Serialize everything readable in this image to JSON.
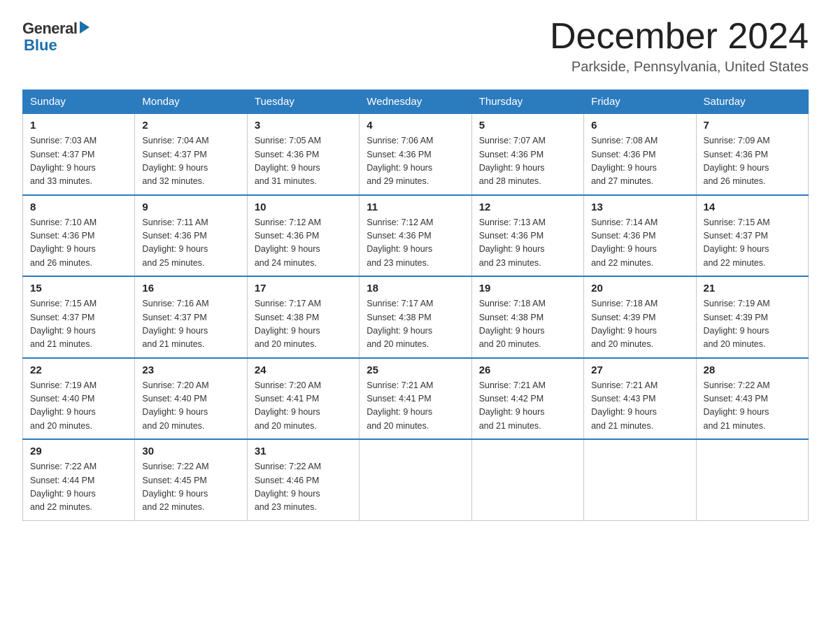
{
  "header": {
    "logo_general": "General",
    "logo_blue": "Blue",
    "month_title": "December 2024",
    "location": "Parkside, Pennsylvania, United States"
  },
  "weekdays": [
    "Sunday",
    "Monday",
    "Tuesday",
    "Wednesday",
    "Thursday",
    "Friday",
    "Saturday"
  ],
  "weeks": [
    [
      {
        "day": "1",
        "sunrise": "7:03 AM",
        "sunset": "4:37 PM",
        "daylight": "9 hours and 33 minutes."
      },
      {
        "day": "2",
        "sunrise": "7:04 AM",
        "sunset": "4:37 PM",
        "daylight": "9 hours and 32 minutes."
      },
      {
        "day": "3",
        "sunrise": "7:05 AM",
        "sunset": "4:36 PM",
        "daylight": "9 hours and 31 minutes."
      },
      {
        "day": "4",
        "sunrise": "7:06 AM",
        "sunset": "4:36 PM",
        "daylight": "9 hours and 29 minutes."
      },
      {
        "day": "5",
        "sunrise": "7:07 AM",
        "sunset": "4:36 PM",
        "daylight": "9 hours and 28 minutes."
      },
      {
        "day": "6",
        "sunrise": "7:08 AM",
        "sunset": "4:36 PM",
        "daylight": "9 hours and 27 minutes."
      },
      {
        "day": "7",
        "sunrise": "7:09 AM",
        "sunset": "4:36 PM",
        "daylight": "9 hours and 26 minutes."
      }
    ],
    [
      {
        "day": "8",
        "sunrise": "7:10 AM",
        "sunset": "4:36 PM",
        "daylight": "9 hours and 26 minutes."
      },
      {
        "day": "9",
        "sunrise": "7:11 AM",
        "sunset": "4:36 PM",
        "daylight": "9 hours and 25 minutes."
      },
      {
        "day": "10",
        "sunrise": "7:12 AM",
        "sunset": "4:36 PM",
        "daylight": "9 hours and 24 minutes."
      },
      {
        "day": "11",
        "sunrise": "7:12 AM",
        "sunset": "4:36 PM",
        "daylight": "9 hours and 23 minutes."
      },
      {
        "day": "12",
        "sunrise": "7:13 AM",
        "sunset": "4:36 PM",
        "daylight": "9 hours and 23 minutes."
      },
      {
        "day": "13",
        "sunrise": "7:14 AM",
        "sunset": "4:36 PM",
        "daylight": "9 hours and 22 minutes."
      },
      {
        "day": "14",
        "sunrise": "7:15 AM",
        "sunset": "4:37 PM",
        "daylight": "9 hours and 22 minutes."
      }
    ],
    [
      {
        "day": "15",
        "sunrise": "7:15 AM",
        "sunset": "4:37 PM",
        "daylight": "9 hours and 21 minutes."
      },
      {
        "day": "16",
        "sunrise": "7:16 AM",
        "sunset": "4:37 PM",
        "daylight": "9 hours and 21 minutes."
      },
      {
        "day": "17",
        "sunrise": "7:17 AM",
        "sunset": "4:38 PM",
        "daylight": "9 hours and 20 minutes."
      },
      {
        "day": "18",
        "sunrise": "7:17 AM",
        "sunset": "4:38 PM",
        "daylight": "9 hours and 20 minutes."
      },
      {
        "day": "19",
        "sunrise": "7:18 AM",
        "sunset": "4:38 PM",
        "daylight": "9 hours and 20 minutes."
      },
      {
        "day": "20",
        "sunrise": "7:18 AM",
        "sunset": "4:39 PM",
        "daylight": "9 hours and 20 minutes."
      },
      {
        "day": "21",
        "sunrise": "7:19 AM",
        "sunset": "4:39 PM",
        "daylight": "9 hours and 20 minutes."
      }
    ],
    [
      {
        "day": "22",
        "sunrise": "7:19 AM",
        "sunset": "4:40 PM",
        "daylight": "9 hours and 20 minutes."
      },
      {
        "day": "23",
        "sunrise": "7:20 AM",
        "sunset": "4:40 PM",
        "daylight": "9 hours and 20 minutes."
      },
      {
        "day": "24",
        "sunrise": "7:20 AM",
        "sunset": "4:41 PM",
        "daylight": "9 hours and 20 minutes."
      },
      {
        "day": "25",
        "sunrise": "7:21 AM",
        "sunset": "4:41 PM",
        "daylight": "9 hours and 20 minutes."
      },
      {
        "day": "26",
        "sunrise": "7:21 AM",
        "sunset": "4:42 PM",
        "daylight": "9 hours and 21 minutes."
      },
      {
        "day": "27",
        "sunrise": "7:21 AM",
        "sunset": "4:43 PM",
        "daylight": "9 hours and 21 minutes."
      },
      {
        "day": "28",
        "sunrise": "7:22 AM",
        "sunset": "4:43 PM",
        "daylight": "9 hours and 21 minutes."
      }
    ],
    [
      {
        "day": "29",
        "sunrise": "7:22 AM",
        "sunset": "4:44 PM",
        "daylight": "9 hours and 22 minutes."
      },
      {
        "day": "30",
        "sunrise": "7:22 AM",
        "sunset": "4:45 PM",
        "daylight": "9 hours and 22 minutes."
      },
      {
        "day": "31",
        "sunrise": "7:22 AM",
        "sunset": "4:46 PM",
        "daylight": "9 hours and 23 minutes."
      },
      null,
      null,
      null,
      null
    ]
  ],
  "labels": {
    "sunrise": "Sunrise: ",
    "sunset": "Sunset: ",
    "daylight": "Daylight: "
  }
}
